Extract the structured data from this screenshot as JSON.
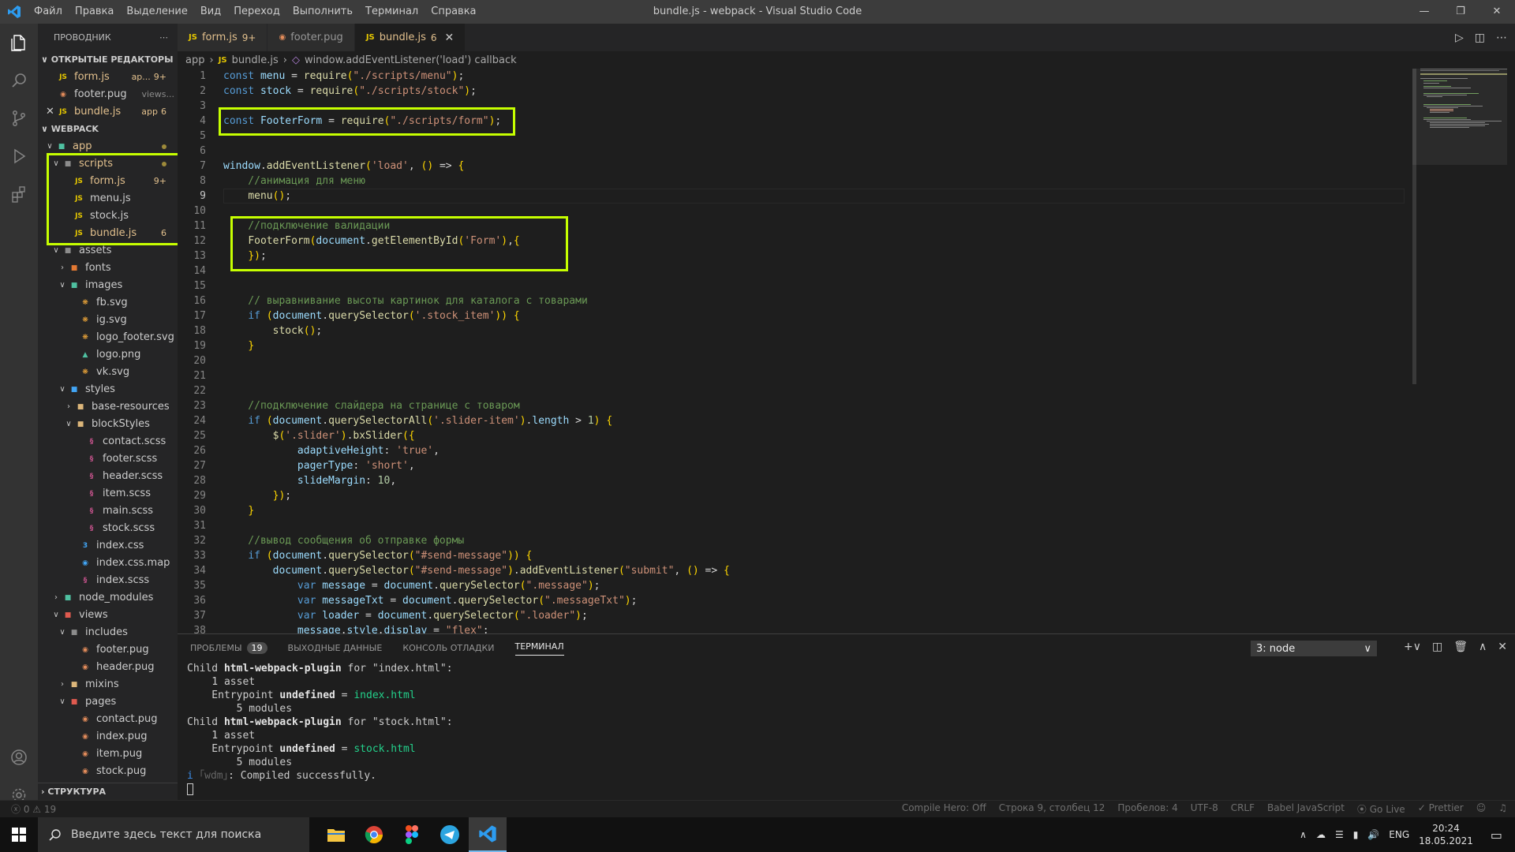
{
  "window": {
    "title": "bundle.js - webpack - Visual Studio Code",
    "menu": [
      "Файл",
      "Правка",
      "Выделение",
      "Вид",
      "Переход",
      "Выполнить",
      "Терминал",
      "Справка"
    ]
  },
  "sidebar": {
    "header": "ПРОВОДНИК",
    "open_editors_label": "ОТКРЫТЫЕ РЕДАКТОРЫ",
    "open_editors": [
      {
        "name": "form.js",
        "detail": "ap...",
        "badge": "9+"
      },
      {
        "name": "footer.pug",
        "detail": "views...",
        "badge": ""
      },
      {
        "name": "bundle.js",
        "detail": "app",
        "badge": "6"
      }
    ],
    "workspace_label": "WEBPACK",
    "tree": {
      "app": "app",
      "scripts": "scripts",
      "form_js": "form.js",
      "form_badge": "9+",
      "menu_js": "menu.js",
      "stock_js": "stock.js",
      "bundle_js": "bundle.js",
      "bundle_badge": "6",
      "assets": "assets",
      "fonts": "fonts",
      "images": "images",
      "fb_svg": "fb.svg",
      "ig_svg": "ig.svg",
      "logo_footer_svg": "logo_footer.svg",
      "logo_png": "logo.png",
      "vk_svg": "vk.svg",
      "styles": "styles",
      "base_resources": "base-resources",
      "blockstyles": "blockStyles",
      "contact_scss": "contact.scss",
      "footer_scss": "footer.scss",
      "header_scss": "header.scss",
      "item_scss": "item.scss",
      "main_scss": "main.scss",
      "stock_scss": "stock.scss",
      "index_css": "index.css",
      "index_css_map": "index.css.map",
      "index_scss": "index.scss",
      "node_modules": "node_modules",
      "views": "views",
      "includes": "includes",
      "footer_pug": "footer.pug",
      "header_pug": "header.pug",
      "mixins": "mixins",
      "pages": "pages",
      "contact_pug": "contact.pug",
      "index_pug": "index.pug",
      "item_pug": "item.pug",
      "stock_pug": "stock.pug"
    },
    "outline_label": "СТРУКТУРА"
  },
  "tabs": [
    {
      "name": "form.js",
      "count": "9+",
      "icon": "JS"
    },
    {
      "name": "footer.pug",
      "count": "",
      "icon": "pug"
    },
    {
      "name": "bundle.js",
      "count": "6",
      "icon": "JS"
    }
  ],
  "breadcrumb": [
    "app",
    "bundle.js",
    "window.addEventListener('load') callback"
  ],
  "editor": {
    "current_line": 9,
    "lines": [
      "const menu = require(\"./scripts/menu\");",
      "const stock = require(\"./scripts/stock\");",
      "",
      "const FooterForm = require(\"./scripts/form\");",
      "",
      "",
      "window.addEventListener('load', () => {",
      "    //анимация для меню",
      "    menu();",
      "",
      "    //подключение валидации",
      "    FooterForm(document.getElementById('Form'),{",
      "    });",
      "",
      "",
      "    // выравнивание высоты картинок для каталога с товарами",
      "    if (document.querySelector('.stock_item')) {",
      "        stock();",
      "    }",
      "",
      "",
      "",
      "    //подключение слайдера на странице с товаром",
      "    if (document.querySelectorAll('.slider-item').length > 1) {",
      "        $('.slider').bxSlider({",
      "            adaptiveHeight: 'true',",
      "            pagerType: 'short',",
      "            slideMargin: 10,",
      "        });",
      "    }",
      "",
      "    //вывод сообщения об отправке формы",
      "    if (document.querySelector(\"#send-message\")) {",
      "        document.querySelector(\"#send-message\").addEventListener(\"submit\", () => {",
      "            var message = document.querySelector(\".message\");",
      "            var messageTxt = document.querySelector(\".messageTxt\");",
      "            var loader = document.querySelector(\".loader\");",
      "            message.style.display = \"flex\";"
    ]
  },
  "panel": {
    "tabs": [
      "ПРОБЛЕМЫ",
      "ВЫХОДНЫЕ ДАННЫЕ",
      "КОНСОЛЬ ОТЛАДКИ",
      "ТЕРМИНАЛ"
    ],
    "problems_count": "19",
    "terminal_select": "3: node",
    "terminal_lines": [
      {
        "prefix": "Child ",
        "bold": "html-webpack-plugin",
        "rest": " for \"index.html\":"
      },
      {
        "text": "    1 asset"
      },
      {
        "text": "    Entrypoint ",
        "bold": "undefined",
        "rest": " = ",
        "green": "index.html"
      },
      {
        "text": "        5 modules"
      },
      {
        "prefix": "Child ",
        "bold": "html-webpack-plugin",
        "rest": " for \"stock.html\":"
      },
      {
        "text": "    1 asset"
      },
      {
        "text": "    Entrypoint ",
        "bold": "undefined",
        "rest": " = ",
        "green": "stock.html"
      },
      {
        "text": "        5 modules"
      },
      {
        "info": "i ",
        "dim": "｢wdm｣",
        "rest": ": Compiled successfully."
      }
    ]
  },
  "statusbar": {
    "errors": "0",
    "warnings": "19",
    "compile_hero": "Compile Hero: Off",
    "position": "Строка 9, столбец 12",
    "spaces": "Пробелов: 4",
    "encoding": "UTF-8",
    "eol": "CRLF",
    "language": "Babel JavaScript",
    "golive": "Go Live",
    "prettier": "Prettier"
  },
  "taskbar": {
    "search_placeholder": "Введите здесь текст для поиска",
    "lang": "ENG",
    "time": "20:24",
    "date": "18.05.2021"
  },
  "colors": {
    "highlight": "#c6ff00",
    "accent": "#007acc"
  }
}
